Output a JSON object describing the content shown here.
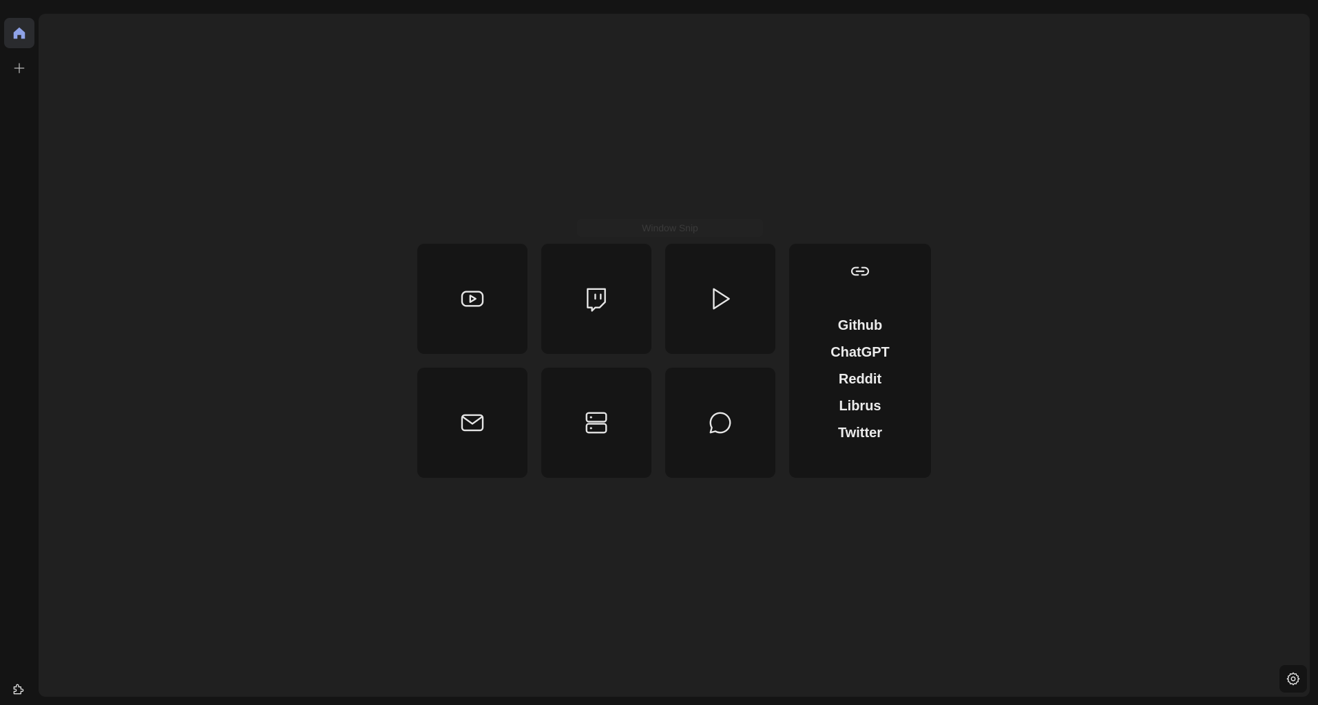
{
  "window_snip_label": "Window Snip",
  "sidebar": {
    "items": [
      {
        "icon": "home-icon",
        "active": true
      },
      {
        "icon": "plus-icon",
        "active": false
      }
    ],
    "bottom_icon": "puzzle-icon"
  },
  "shortcut_tiles": [
    {
      "icon": "youtube-icon"
    },
    {
      "icon": "twitch-icon"
    },
    {
      "icon": "play-icon"
    },
    {
      "icon": "mail-icon"
    },
    {
      "icon": "server-icon"
    },
    {
      "icon": "chat-bubble-icon"
    }
  ],
  "links_panel": {
    "icon": "link-icon",
    "links": [
      "Github",
      "ChatGPT",
      "Reddit",
      "Librus",
      "Twitter"
    ]
  },
  "settings_icon": "gear-icon",
  "colors": {
    "background": "#141414",
    "panel": "#202020",
    "tile": "#151515",
    "accent": "#8fa3e8",
    "icon": "#e6e6e6"
  }
}
